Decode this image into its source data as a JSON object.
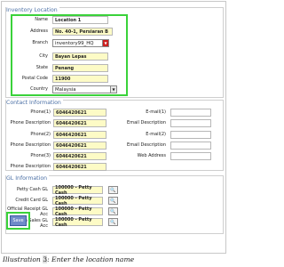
{
  "sections": {
    "inventory_title": "Inventory Location",
    "contact_title": "Contact Information",
    "gl_title": "GL Information"
  },
  "inventory": {
    "name_label": "Name",
    "name_value": "Location 1",
    "address_label": "Address",
    "address_value": "No. 40-1, Persiaran B",
    "branch_label": "Branch",
    "branch_value": "inventory99_HQ",
    "city_label": "City",
    "city_value": "Bayan Lepas",
    "state_label": "State",
    "state_value": "Penang",
    "postal_label": "Postal Code",
    "postal_value": "11900",
    "country_label": "Country",
    "country_value": "Malaysia"
  },
  "contact": {
    "phone1_label": "Phone(1)",
    "phone1_value": "6046420621",
    "phone1_desc_label": "Phone Description",
    "phone1_desc_value": "6046420621",
    "phone2_label": "Phone(2)",
    "phone2_value": "6046420621",
    "phone2_desc_label": "Phone Description",
    "phone2_desc_value": "6046420621",
    "phone3_label": "Phone(3)",
    "phone3_value": "6046420621",
    "phone3_desc_label": "Phone Description",
    "phone3_desc_value": "6046420621",
    "email1_label": "E-mail(1)",
    "email_desc1_label": "Email Description",
    "email2_label": "E-mail(2)",
    "email_desc2_label": "Email Description",
    "web_label": "Web Address"
  },
  "gl": {
    "petty_label": "Petty Cash GL",
    "petty_value": "100000 - Petty Cash",
    "credit_label": "Credit Card GL",
    "credit_value": "100000 - Petty Cash",
    "official_label_1": "Official Receipt GL",
    "official_label_2": "Acc",
    "official_value": "100000 - Petty Cash",
    "cashsales_label_1": "Cash Sales GL",
    "cashsales_label_2": "Acc",
    "cashsales_value": "100000 - Petty Cash"
  },
  "buttons": {
    "save_label": "Save"
  },
  "caption": {
    "prefix": "Illustration ",
    "number": "3",
    "suffix": ": Enter the location name"
  },
  "colors": {
    "highlight_box": "#3ad23a",
    "field_fill": "#fdfbc6",
    "section_title": "#4a6fa5",
    "save_button": "#6f8bc9"
  },
  "icons": {
    "lookup": "magnifier-icon",
    "dropdown": "chevron-down-icon"
  }
}
